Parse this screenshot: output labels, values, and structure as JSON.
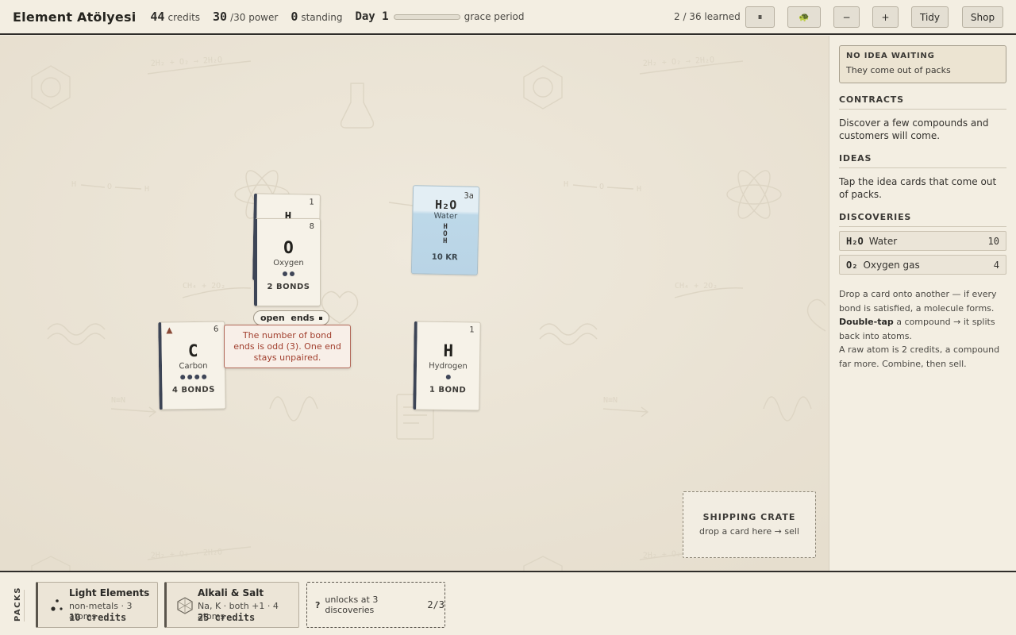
{
  "header": {
    "title": "Element Atölyesi",
    "credits": {
      "value": "44",
      "label": "credits"
    },
    "power": {
      "value": "30",
      "label": "/30 power"
    },
    "standing": {
      "value": "0",
      "label": "standing"
    },
    "day": {
      "label": "Day 1",
      "progress": 0,
      "status": "grace period"
    },
    "learned": "2 / 36 learned",
    "buttons": {
      "pause": "⏸",
      "speed": "🐢",
      "zoom_out": "−",
      "zoom_in": "+",
      "tidy": "Tidy",
      "shop": "Shop"
    }
  },
  "board": {
    "cards": {
      "hidden_top": {
        "atomic": "1",
        "symbol": "H"
      },
      "oxygen": {
        "atomic": "8",
        "symbol": "O",
        "name": "Oxygen",
        "bonds": "2 BONDS",
        "dot_count": 2
      },
      "water": {
        "formula": "H₂O",
        "corner": "3a",
        "name": "Water",
        "structure": [
          "H",
          "O",
          "H"
        ],
        "price": "10 KR"
      },
      "carbon": {
        "atomic": "6",
        "symbol": "C",
        "name": "Carbon",
        "bonds": "4 BONDS",
        "dot_count": 4
      },
      "hydrogen": {
        "atomic": "1",
        "symbol": "H",
        "name": "Hydrogen",
        "bonds": "1 BOND",
        "dot_count": 1
      }
    },
    "open_ends_label": "open  ends",
    "tooltip": "The number of bond ends is odd (3). One end stays unpaired.",
    "shipping_crate": {
      "title": "SHIPPING CRATE",
      "subtitle": "drop a card here → sell"
    },
    "background_labels": {
      "eq1": "2H₂ + O₂ → 2H₂O",
      "eq2": "CH₄ + 2O₂",
      "h": "H",
      "o": "O",
      "n2": "N≡N"
    }
  },
  "sidebar": {
    "idea": {
      "title": "NO IDEA WAITING",
      "subtitle": "They come out of packs"
    },
    "contracts": {
      "title": "CONTRACTS",
      "text": "Discover a few compounds and customers will come."
    },
    "ideas": {
      "title": "IDEAS",
      "text": "Tap the idea cards that come out of packs."
    },
    "discoveries": {
      "title": "DISCOVERIES",
      "items": [
        {
          "formula": "H₂O",
          "name": "Water",
          "value": "10"
        },
        {
          "formula": "O₂",
          "name": "Oxygen gas",
          "value": "4"
        }
      ]
    },
    "help": {
      "p1": "Drop a card onto another — if every bond is satisfied, a molecule forms.",
      "p2_bold": "Double-tap",
      "p2": " a compound → it splits back into atoms.",
      "p3": "A raw atom is 2 credits, a compound far more. Combine, then sell."
    }
  },
  "packs": {
    "label": "PACKS",
    "items": [
      {
        "name": "Light Elements",
        "desc": "non-metals · 3 atoms",
        "cost": "10 credits"
      },
      {
        "name": "Alkali & Salt",
        "desc": "Na, K · both +1 · 4 atoms",
        "cost": "25 credits"
      }
    ],
    "locked": {
      "icon": "?",
      "text": "unlocks at 3 discoveries",
      "progress": "2/3"
    }
  }
}
